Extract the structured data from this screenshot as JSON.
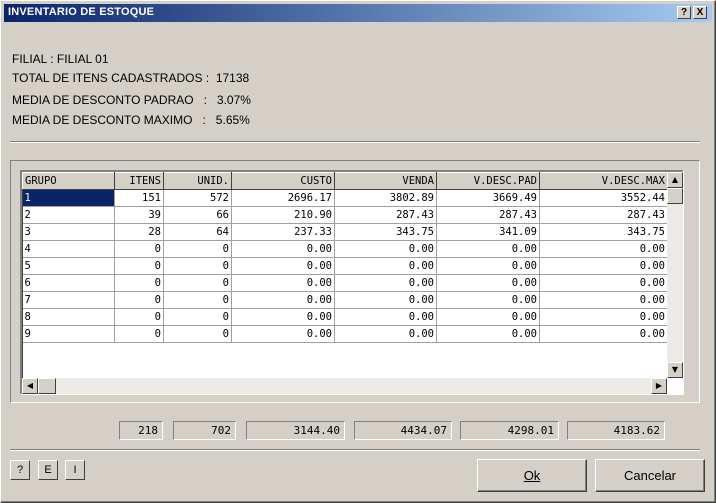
{
  "window": {
    "title": "INVENTARIO DE ESTOQUE",
    "help_button": "?",
    "close_button": "X"
  },
  "info": {
    "filial": "FILIAL : FILIAL 01",
    "total_itens": "TOTAL DE ITENS CADASTRADOS :  17138",
    "media_padrao": "MEDIA DE DESCONTO PADRAO   :   3.07%",
    "media_maximo": "MEDIA DE DESCONTO MAXIMO   :   5.65%"
  },
  "grid": {
    "columns": [
      "GRUPO",
      "ITENS",
      "UNID.",
      "CUSTO",
      "VENDA",
      "V.DESC.PAD",
      "V.DESC.MAX"
    ],
    "rows": [
      [
        "1",
        "151",
        "572",
        "2696.17",
        "3802.89",
        "3669.49",
        "3552.44"
      ],
      [
        "2",
        "39",
        "66",
        "210.90",
        "287.43",
        "287.43",
        "287.43"
      ],
      [
        "3",
        "28",
        "64",
        "237.33",
        "343.75",
        "341.09",
        "343.75"
      ],
      [
        "4",
        "0",
        "0",
        "0.00",
        "0.00",
        "0.00",
        "0.00"
      ],
      [
        "5",
        "0",
        "0",
        "0.00",
        "0.00",
        "0.00",
        "0.00"
      ],
      [
        "6",
        "0",
        "0",
        "0.00",
        "0.00",
        "0.00",
        "0.00"
      ],
      [
        "7",
        "0",
        "0",
        "0.00",
        "0.00",
        "0.00",
        "0.00"
      ],
      [
        "8",
        "0",
        "0",
        "0.00",
        "0.00",
        "0.00",
        "0.00"
      ],
      [
        "9",
        "0",
        "0",
        "0.00",
        "0.00",
        "0.00",
        "0.00"
      ]
    ]
  },
  "totals": [
    "218",
    "702",
    "3144.40",
    "4434.07",
    "4298.01",
    "4183.62"
  ],
  "buttons": {
    "help": "?",
    "e": "E",
    "i": "I",
    "ok": "Ok",
    "cancel": "Cancelar"
  },
  "colors": {
    "title_start": "#0a246a",
    "title_end": "#a6caf0",
    "face": "#d4d0c8",
    "selection": "#0a246a"
  }
}
